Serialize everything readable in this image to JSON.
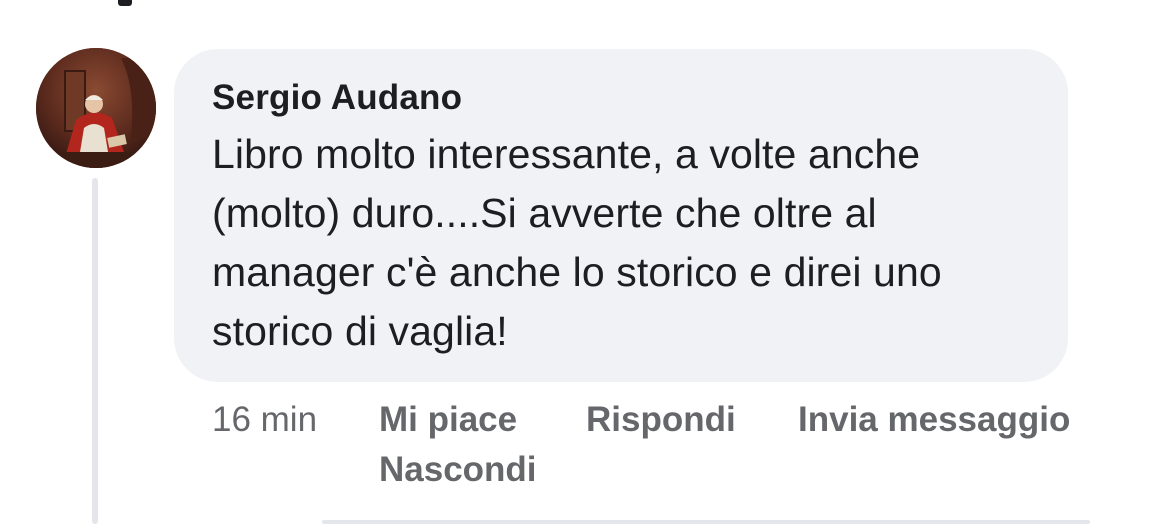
{
  "comment": {
    "author": "Sergio Audano",
    "text": "Libro molto interessante, a volte anche (molto) duro....Si avverte che oltre al manager c'è anche lo storico e direi uno storico di vaglia!",
    "avatar_icon": "portrait-painting-avatar"
  },
  "actions": {
    "time": "16 min",
    "like_label": "Mi piace",
    "reply_label": "Rispondi",
    "message_label": "Invia messaggio",
    "hide_label": "Nascondi"
  },
  "colors": {
    "bubble": "#f0f2f5",
    "text": "#1c1e21",
    "secondary": "#65676b",
    "thread_line": "#e4e6eb"
  }
}
